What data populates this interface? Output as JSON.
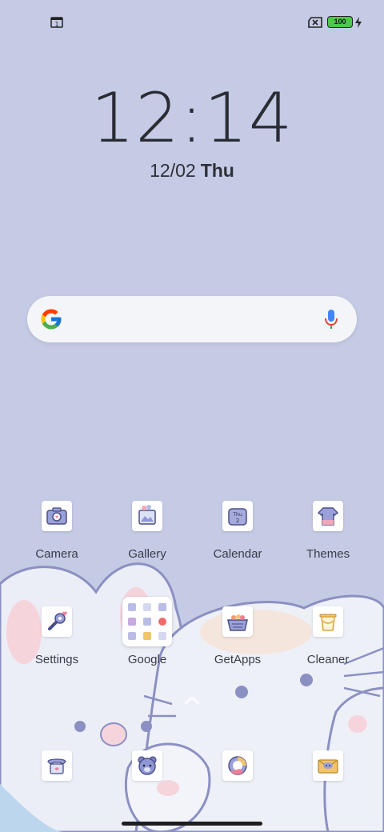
{
  "status_bar": {
    "sim_icon": "sim-card-icon",
    "sim_slot": "1",
    "no_sim_icon": "no-sim-icon",
    "battery_level": "100",
    "charging_icon": "charging-bolt-icon"
  },
  "clock": {
    "time": "12:14",
    "date": "12/02",
    "weekday": "Thu"
  },
  "search_bar": {
    "logo": "google-g-icon",
    "mic": "microphone-icon"
  },
  "apps": {
    "camera": "Camera",
    "gallery": "Gallery",
    "calendar": "Calendar",
    "calendar_icon_day": "Thu",
    "calendar_icon_date": "2",
    "themes": "Themes",
    "settings": "Settings",
    "google": "Google",
    "getapps": "GetApps",
    "cleaner": "Cleaner"
  },
  "dock": [
    "phone-icon",
    "bear-icon",
    "browser-icon",
    "messages-icon"
  ],
  "colors": {
    "wallpaper": "#c5cbe5",
    "accent": "#6a6fb5",
    "battery": "#4cc94a"
  }
}
